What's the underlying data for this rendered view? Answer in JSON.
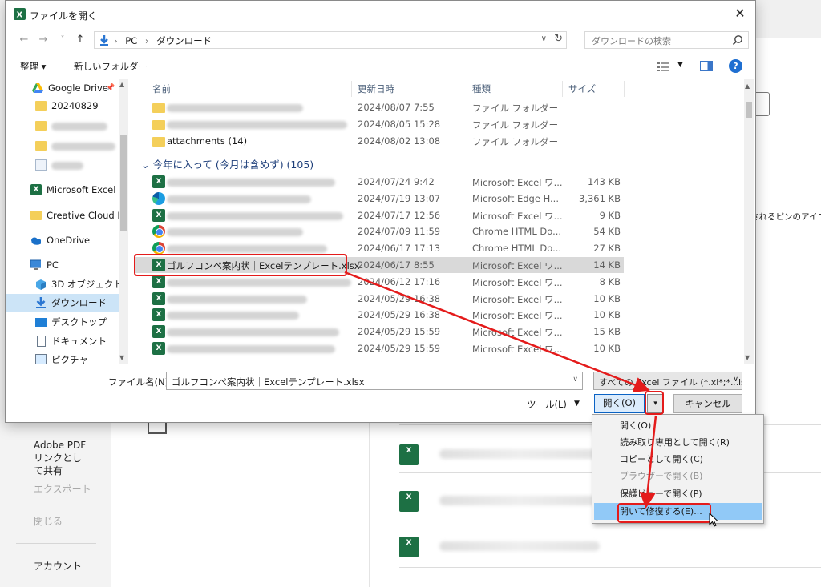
{
  "dialog": {
    "title": "ファイルを開く",
    "close_glyph": "✕"
  },
  "nav": {
    "back": "←",
    "forward": "→",
    "recent": "˅",
    "up": "↑",
    "breadcrumb": [
      "PC",
      "ダウンロード"
    ],
    "crumb_sep": "›",
    "search_placeholder": "ダウンロードの検索"
  },
  "cmdbar": {
    "organize": "整理 ▾",
    "new_folder": "新しいフォルダー"
  },
  "navpane": {
    "items": [
      {
        "label": "Google Drive",
        "icon": "google-drive-icon",
        "pin": "📌"
      },
      {
        "label": "20240829",
        "icon": "folder-icon"
      },
      {
        "label": "",
        "icon": "folder-icon",
        "blurred": true
      },
      {
        "label": "",
        "icon": "folder-icon",
        "blurred": true
      },
      {
        "label": "",
        "icon": "image-folder-icon",
        "blurred": true
      },
      {
        "label": "Microsoft Excel",
        "icon": "excel-icon"
      },
      {
        "label": "Creative Cloud File",
        "icon": "folder-icon"
      },
      {
        "label": "OneDrive",
        "icon": "onedrive-icon"
      },
      {
        "label": "PC",
        "icon": "pc-icon"
      },
      {
        "label": "3D オブジェクト",
        "icon": "3d-objects-icon"
      },
      {
        "label": "ダウンロード",
        "icon": "downloads-icon",
        "selected": true
      },
      {
        "label": "デスクトップ",
        "icon": "desktop-icon"
      },
      {
        "label": "ドキュメント",
        "icon": "documents-icon"
      },
      {
        "label": "ピクチャ",
        "icon": "pictures-icon"
      }
    ]
  },
  "filelist": {
    "columns": [
      "名前",
      "更新日時",
      "種類",
      "サイズ"
    ],
    "top_rows": [
      {
        "name": "",
        "blurred": true,
        "date": "2024/08/07 7:55",
        "type": "ファイル フォルダー",
        "size": ""
      },
      {
        "name": "",
        "blurred": true,
        "date": "2024/08/05 15:28",
        "type": "ファイル フォルダー",
        "size": ""
      },
      {
        "name": "attachments (14)",
        "date": "2024/08/02 13:08",
        "type": "ファイル フォルダー",
        "size": ""
      }
    ],
    "group_header": "今年に入って (今月は含めず) (105)",
    "group_chevron": "⌄",
    "rows": [
      {
        "icon": "excel-icon",
        "name": "",
        "blurred": true,
        "date": "2024/07/24 9:42",
        "type": "Microsoft Excel ワ...",
        "size": "143 KB"
      },
      {
        "icon": "edge-icon",
        "name": "",
        "blurred": true,
        "date": "2024/07/19 13:07",
        "type": "Microsoft Edge H...",
        "size": "3,361 KB"
      },
      {
        "icon": "excel-icon",
        "name": "",
        "blurred": true,
        "date": "2024/07/17 12:56",
        "type": "Microsoft Excel ワ...",
        "size": "9 KB"
      },
      {
        "icon": "chrome-icon",
        "name": "",
        "blurred": true,
        "date": "2024/07/09 11:59",
        "type": "Chrome HTML Do...",
        "size": "54 KB"
      },
      {
        "icon": "chrome-icon",
        "name": "",
        "blurred": true,
        "date": "2024/06/17 17:13",
        "type": "Chrome HTML Do...",
        "size": "27 KB"
      },
      {
        "icon": "excel-icon",
        "name": "ゴルフコンペ案内状｜Excelテンプレート.xlsx",
        "selected": true,
        "date": "2024/06/17 8:55",
        "type": "Microsoft Excel ワ...",
        "size": "14 KB"
      },
      {
        "icon": "excel-icon",
        "name": "",
        "blurred": true,
        "date": "2024/06/12 17:16",
        "type": "Microsoft Excel ワ...",
        "size": "8 KB"
      },
      {
        "icon": "excel-icon",
        "name": "",
        "blurred": true,
        "date": "2024/05/29 16:38",
        "type": "Microsoft Excel ワ...",
        "size": "10 KB"
      },
      {
        "icon": "excel-icon",
        "name": "",
        "blurred": true,
        "date": "2024/05/29 16:38",
        "type": "Microsoft Excel ワ...",
        "size": "10 KB"
      },
      {
        "icon": "excel-icon",
        "name": "",
        "blurred": true,
        "date": "2024/05/29 15:59",
        "type": "Microsoft Excel ワ...",
        "size": "15 KB"
      },
      {
        "icon": "excel-icon",
        "name": "",
        "blurred": true,
        "date": "2024/05/29 15:59",
        "type": "Microsoft Excel ワ...",
        "size": "10 KB"
      }
    ]
  },
  "footer": {
    "filename_label": "ファイル名(N):",
    "filename_value": "ゴルフコンペ案内状｜Excelテンプレート.xlsx",
    "filter_value": "すべての Excel ファイル (*.xl*;*.xlsx",
    "tools_label": "ツール(L)",
    "open_label": "開く(O)",
    "split_glyph": "▾",
    "cancel_label": "キャンセル",
    "dd_glyph": "∨"
  },
  "open_menu": {
    "items": [
      {
        "label": "開く(O)"
      },
      {
        "label": "読み取り専用として開く(R)"
      },
      {
        "label": "コピーとして開く(C)"
      },
      {
        "label": "ブラウザーで開く(B)",
        "disabled": true
      },
      {
        "label": "保護ビューで開く(P)"
      },
      {
        "label": "開いて修復する(E)...",
        "highlighted": true
      }
    ]
  },
  "background": {
    "nav": [
      "Adobe PDF リンクとして共有",
      "エクスポート",
      "閉じる",
      "アカウント"
    ],
    "hint": "されるピンのアイコン"
  },
  "colors": {
    "annotation_red": "#e41b1b",
    "excel_green": "#1d7044",
    "menu_highlight": "#91c9f7",
    "selected_row": "#d9d9d9"
  }
}
